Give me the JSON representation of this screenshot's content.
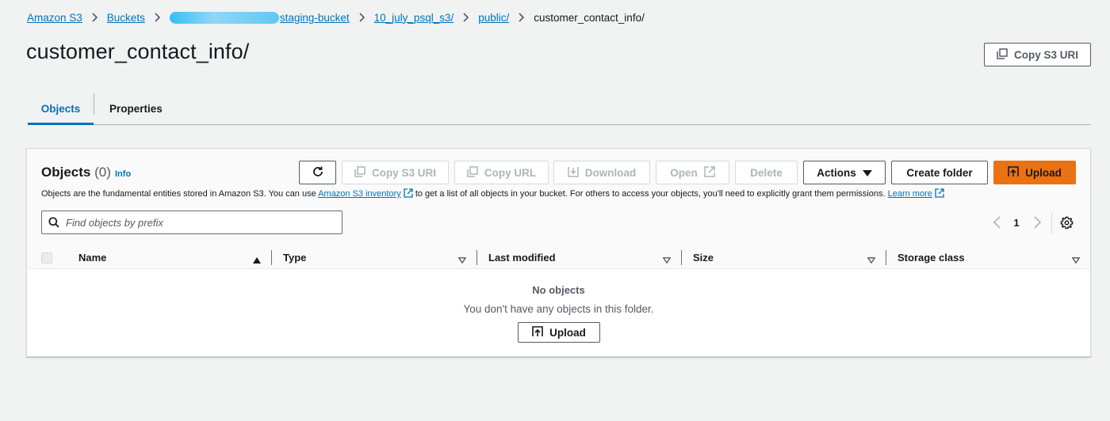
{
  "breadcrumb": {
    "items": [
      "Amazon S3",
      "Buckets",
      "staging-bucket",
      "10_july_psql_s3/",
      "public/"
    ],
    "current": "customer_contact_info/"
  },
  "page": {
    "title": "customer_contact_info/",
    "copy_s3_uri_label": "Copy S3 URI"
  },
  "tabs": [
    {
      "label": "Objects",
      "active": true
    },
    {
      "label": "Properties",
      "active": false
    }
  ],
  "objects_panel": {
    "title": "Objects",
    "count": "(0)",
    "info_label": "Info",
    "description_pre": "Objects are the fundamental entities stored in Amazon S3. You can use",
    "inventory_link": "Amazon S3 inventory",
    "description_mid": "to get a list of all objects in your bucket. For others to access your objects, you'll need to explicitly grant them permissions.",
    "learn_more_link": "Learn more",
    "toolbar": {
      "copy_s3_uri": "Copy S3 URI",
      "copy_url": "Copy URL",
      "download": "Download",
      "open": "Open",
      "delete": "Delete",
      "actions": "Actions",
      "create_folder": "Create folder",
      "upload": "Upload"
    },
    "search": {
      "placeholder": "Find objects by prefix",
      "value": ""
    },
    "pagination": {
      "current_page": "1"
    },
    "columns": [
      "Name",
      "Type",
      "Last modified",
      "Size",
      "Storage class"
    ],
    "empty": {
      "title": "No objects",
      "message": "You don't have any objects in this folder.",
      "upload_label": "Upload"
    }
  },
  "colors": {
    "link": "#0073bb",
    "primary": "#ec7211",
    "background": "#f1f2f2",
    "text": "#16191f"
  },
  "icons": [
    "chevron-right-icon",
    "copy-icon",
    "refresh-icon",
    "download-icon",
    "external-link-icon",
    "caret-down-icon",
    "upload-icon",
    "search-icon",
    "chevron-left-icon",
    "settings-gear-icon",
    "sort-ascending-icon",
    "sort-descending-icon"
  ]
}
